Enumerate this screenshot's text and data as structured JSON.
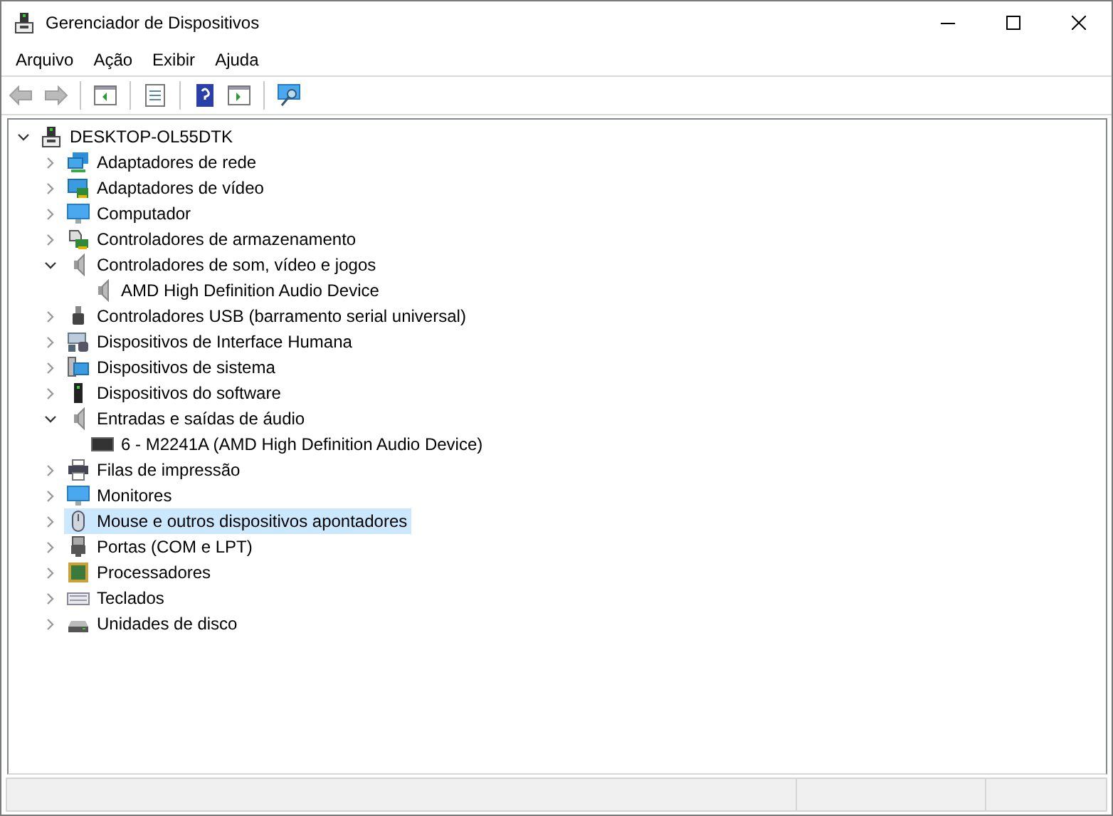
{
  "window": {
    "title": "Gerenciador de Dispositivos"
  },
  "menu": [
    "Arquivo",
    "Ação",
    "Exibir",
    "Ajuda"
  ],
  "toolbar": [
    {
      "kind": "back",
      "disabled": true
    },
    {
      "kind": "forward",
      "disabled": true
    },
    {
      "kind": "tree",
      "disabled": false
    },
    {
      "kind": "properties",
      "disabled": false
    },
    {
      "kind": "help",
      "disabled": false
    },
    {
      "kind": "pane",
      "disabled": false
    },
    {
      "kind": "scan",
      "disabled": false
    }
  ],
  "tree": {
    "label": "DESKTOP-OL55DTK",
    "expanded": true,
    "children": [
      {
        "label": "Adaptadores de rede",
        "expanded": false,
        "selected": false
      },
      {
        "label": "Adaptadores de vídeo",
        "expanded": false,
        "selected": false
      },
      {
        "label": "Computador",
        "expanded": false,
        "selected": false
      },
      {
        "label": "Controladores de armazenamento",
        "expanded": false,
        "selected": false
      },
      {
        "label": "Controladores de som, vídeo e jogos",
        "expanded": true,
        "selected": false,
        "children": [
          {
            "label": "AMD High Definition Audio Device",
            "selected": false
          }
        ]
      },
      {
        "label": "Controladores USB (barramento serial universal)",
        "expanded": false,
        "selected": false
      },
      {
        "label": "Dispositivos de Interface Humana",
        "expanded": false,
        "selected": false
      },
      {
        "label": "Dispositivos de sistema",
        "expanded": false,
        "selected": false
      },
      {
        "label": "Dispositivos do software",
        "expanded": false,
        "selected": false
      },
      {
        "label": "Entradas e saídas de áudio",
        "expanded": true,
        "selected": false,
        "children": [
          {
            "label": "6 - M2241A (AMD High Definition Audio Device)",
            "selected": false
          }
        ]
      },
      {
        "label": "Filas de impressão",
        "expanded": false,
        "selected": false
      },
      {
        "label": "Monitores",
        "expanded": false,
        "selected": false
      },
      {
        "label": "Mouse e outros dispositivos apontadores",
        "expanded": false,
        "selected": true
      },
      {
        "label": "Portas (COM e LPT)",
        "expanded": false,
        "selected": false
      },
      {
        "label": "Processadores",
        "expanded": false,
        "selected": false
      },
      {
        "label": "Teclados",
        "expanded": false,
        "selected": false
      },
      {
        "label": "Unidades de disco",
        "expanded": false,
        "selected": false
      }
    ]
  }
}
